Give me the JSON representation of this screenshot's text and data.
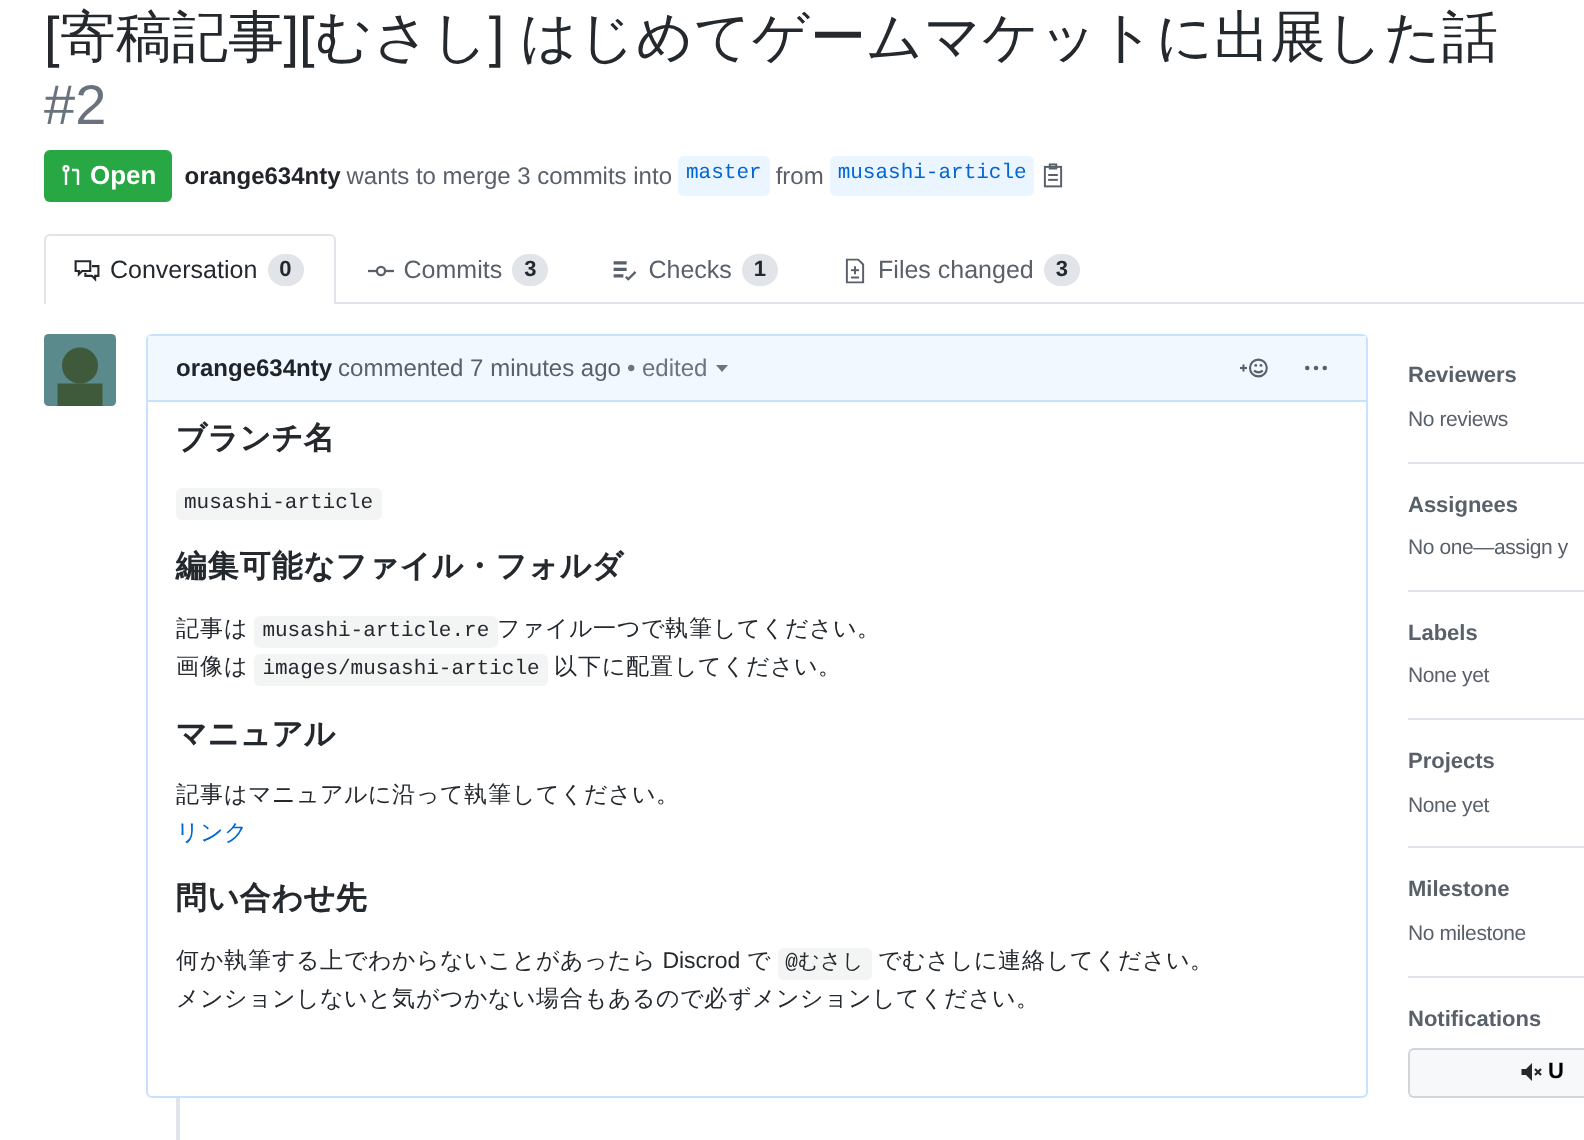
{
  "title": {
    "text": "[寄稿記事][むさし] はじめてゲームマケットに出展した話",
    "number": "#2"
  },
  "state": {
    "label": "Open",
    "kind": "open"
  },
  "merge_info": {
    "author": "orange634nty",
    "text": "wants to merge 3 commits into",
    "base": "master",
    "from": "from",
    "head": "musashi-article"
  },
  "tabs": [
    {
      "label": "Conversation",
      "count": "0",
      "selected": true,
      "kind": "conversation"
    },
    {
      "label": "Commits",
      "count": "3",
      "selected": false,
      "kind": "commits"
    },
    {
      "label": "Checks",
      "count": "1",
      "selected": false,
      "kind": "checks"
    },
    {
      "label": "Files changed",
      "count": "3",
      "selected": false,
      "kind": "files"
    }
  ],
  "comment": {
    "author": "orange634nty",
    "action": "commented 7 minutes ago",
    "edited": "• edited",
    "body": [
      {
        "kind": "heading",
        "text": "ブランチ名"
      },
      {
        "kind": "paragraph",
        "lines": [
          [
            {
              "kind": "code",
              "text": "musashi-article"
            }
          ]
        ]
      },
      {
        "kind": "heading",
        "text": "編集可能なファイル・フォルダ"
      },
      {
        "kind": "paragraph",
        "lines": [
          [
            {
              "kind": "text",
              "text": "記事は "
            },
            {
              "kind": "code",
              "text": "musashi-article.re"
            },
            {
              "kind": "text",
              "text": "ファイル一つで執筆してください。"
            }
          ],
          [
            {
              "kind": "text",
              "text": "画像は "
            },
            {
              "kind": "code",
              "text": "images/musashi-article"
            },
            {
              "kind": "text",
              "text": " 以下に配置してください。"
            }
          ]
        ]
      },
      {
        "kind": "heading",
        "text": "マニュアル"
      },
      {
        "kind": "paragraph",
        "lines": [
          [
            {
              "kind": "text",
              "text": "記事はマニュアルに沿って執筆してください。"
            }
          ],
          [
            {
              "kind": "link",
              "text": "リンク"
            }
          ]
        ]
      },
      {
        "kind": "heading",
        "text": "問い合わせ先"
      },
      {
        "kind": "paragraph",
        "lines": [
          [
            {
              "kind": "text",
              "text": "何か執筆する上でわからないことがあったら Discrod で "
            },
            {
              "kind": "code",
              "text": "@むさし"
            },
            {
              "kind": "text",
              "text": " でむさしに連絡してください。"
            }
          ],
          [
            {
              "kind": "text",
              "text": "メンションしないと気がつかない場合もあるので必ずメンションしてください。"
            }
          ]
        ]
      }
    ]
  },
  "sidebar": [
    {
      "heading": "Reviewers",
      "value": "No reviews"
    },
    {
      "heading": "Assignees",
      "value": "No one—assign y"
    },
    {
      "heading": "Labels",
      "value": "None yet"
    },
    {
      "heading": "Projects",
      "value": "None yet"
    },
    {
      "heading": "Milestone",
      "value": "No milestone"
    }
  ],
  "notifications": {
    "heading": "Notifications",
    "button": "U"
  }
}
